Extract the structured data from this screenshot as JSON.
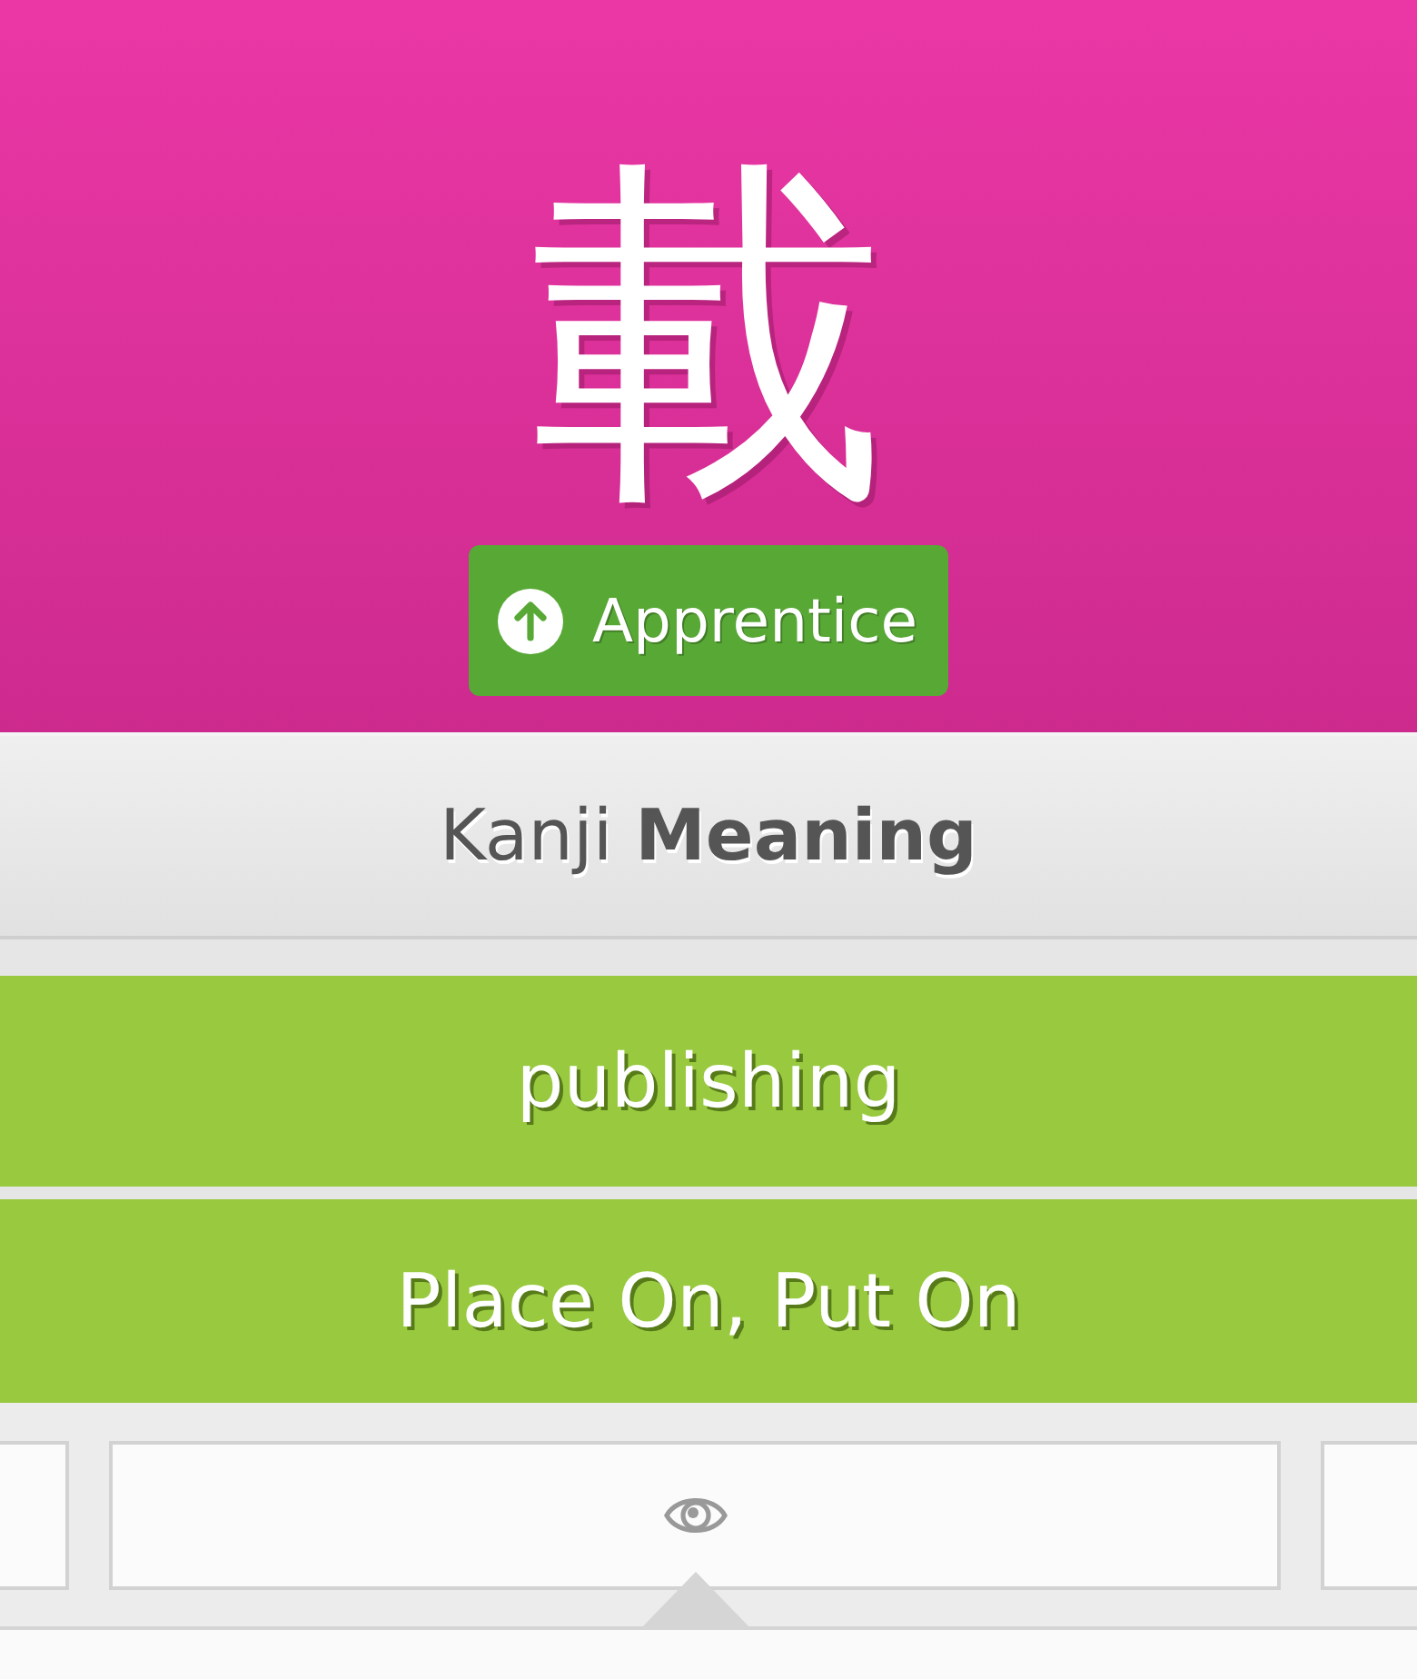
{
  "header": {
    "character": "載",
    "srs_badge": {
      "label": "Apprentice"
    }
  },
  "prompt": {
    "text": "Kanji **Meaning**"
  },
  "answer": {
    "value": "publishing",
    "correct": true
  },
  "meanings": {
    "text": "Place On, Put On",
    "correct": true
  },
  "toolbar": {
    "buttons": [
      {
        "kind": "blank",
        "selected": false
      },
      {
        "kind": "eye",
        "selected": true
      },
      {
        "kind": "blank",
        "selected": false
      }
    ]
  }
}
